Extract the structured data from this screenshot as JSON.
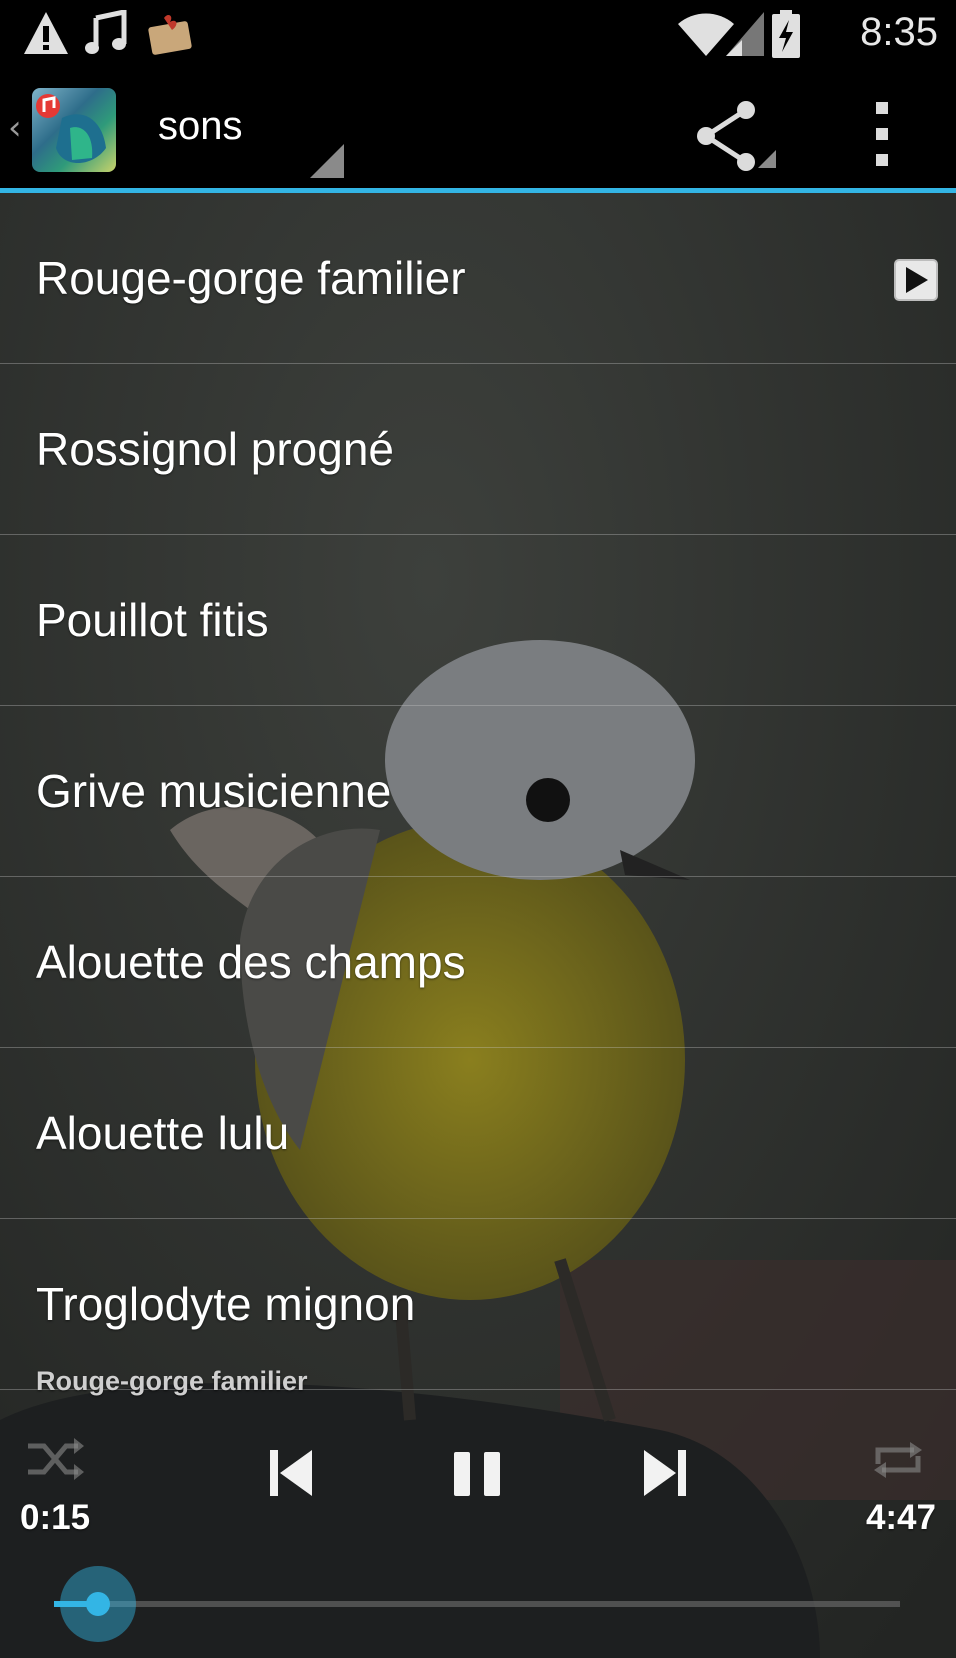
{
  "status_bar": {
    "time": "8:35",
    "icons": [
      "warning-icon",
      "music-note-icon",
      "mail-icon",
      "wifi-icon",
      "signal-icon",
      "battery-charging-icon"
    ]
  },
  "action_bar": {
    "title": "sons",
    "icons": [
      "back-chevron-icon",
      "app-icon",
      "share-icon",
      "overflow-menu-icon"
    ]
  },
  "list": {
    "items": [
      {
        "label": "Rouge-gorge familier",
        "playing": true
      },
      {
        "label": "Rossignol progné"
      },
      {
        "label": "Pouillot fitis"
      },
      {
        "label": "Grive musicienne"
      },
      {
        "label": "Alouette des champs"
      },
      {
        "label": "Alouette lulu"
      },
      {
        "label": "Troglodyte mignon"
      }
    ]
  },
  "player": {
    "now_playing": "Rouge-gorge familier",
    "elapsed": "0:15",
    "total": "4:47",
    "progress": 0.052,
    "controls": [
      "shuffle-icon",
      "previous-icon",
      "pause-icon",
      "next-icon",
      "repeat-icon"
    ]
  },
  "colors": {
    "accent": "#33b5e5",
    "bar_background": "#000000"
  }
}
